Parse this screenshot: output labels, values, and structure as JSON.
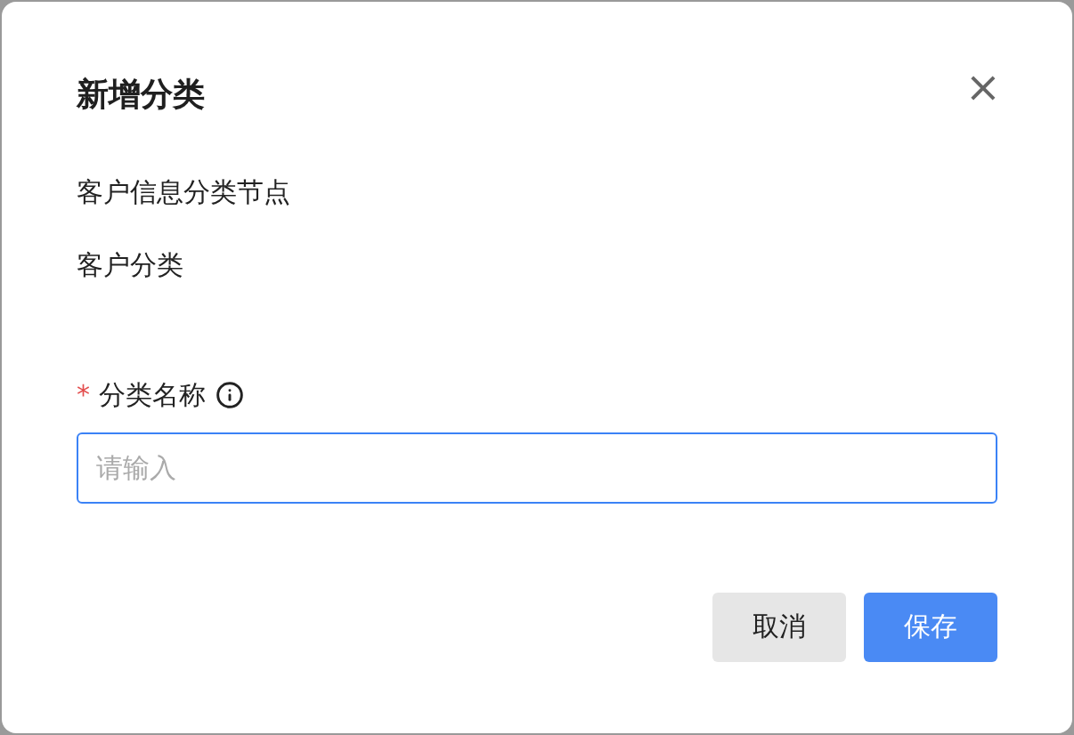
{
  "dialog": {
    "title": "新增分类",
    "close": "×",
    "lines": [
      "客户信息分类节点",
      "客户分类"
    ],
    "field": {
      "label": "分类名称",
      "required_mark": "*",
      "required": true,
      "placeholder": "请输入"
    },
    "buttons": [
      {
        "label": "取消",
        "kind": "secondary"
      },
      {
        "label": "保存",
        "kind": "primary"
      }
    ]
  }
}
